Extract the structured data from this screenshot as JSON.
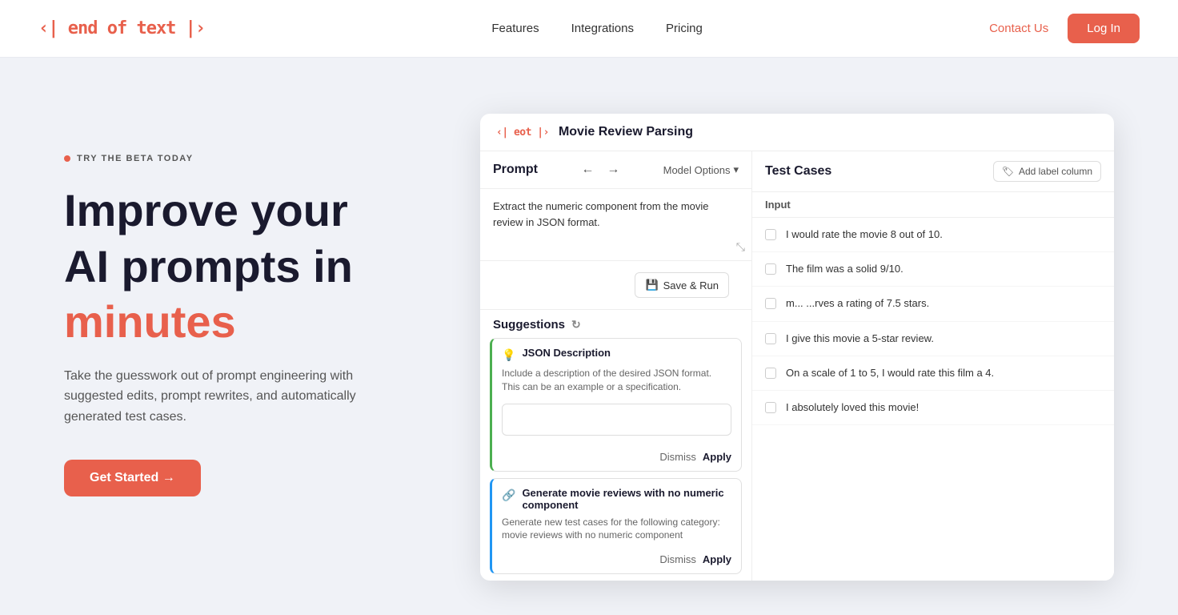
{
  "nav": {
    "logo": "‹| end of text |›",
    "links": [
      {
        "label": "Features",
        "id": "features"
      },
      {
        "label": "Integrations",
        "id": "integrations"
      },
      {
        "label": "Pricing",
        "id": "pricing"
      }
    ],
    "contact_label": "Contact Us",
    "login_label": "Log In"
  },
  "hero": {
    "badge": "TRY THE BETA TODAY",
    "title_line1": "Improve your",
    "title_line2": "AI prompts in",
    "title_accent": "minutes",
    "subtitle": "Take the guesswork out of prompt engineering with suggested edits, prompt rewrites, and automatically generated test cases.",
    "cta_label": "Get Started →"
  },
  "app": {
    "logo": "‹| eot |›",
    "title": "Movie Review Parsing",
    "prompt_label": "Prompt",
    "model_options_label": "Model Options",
    "prompt_text": "Extract the numeric component from the movie review in JSON format.",
    "save_run_label": "Save & Run",
    "suggestions_label": "Suggestions",
    "suggestions": [
      {
        "id": "json",
        "icon": "💡",
        "title": "JSON Description",
        "desc": "Include a description of the desired JSON format. This can be an example or a specification.",
        "has_input": true,
        "dismiss_label": "Dismiss",
        "apply_label": "Apply",
        "border_color": "#4caf50"
      },
      {
        "id": "generate",
        "icon": "🔗",
        "title": "Generate movie reviews with no numeric component",
        "desc": "Generate new test cases for the following category: movie reviews with no numeric component",
        "has_input": false,
        "dismiss_label": "Dismiss",
        "apply_label": "Apply",
        "border_color": "#2196f3"
      }
    ],
    "test_cases_label": "Test Cases",
    "add_label_col_label": "Add label column",
    "input_col_header": "Input",
    "test_rows": [
      {
        "text": "I would rate the movie 8 out of 10."
      },
      {
        "text": "The film was a solid 9/10."
      },
      {
        "text": "m... ...rves a rating of 7.5 stars."
      },
      {
        "text": "I give this movie a 5-star review."
      },
      {
        "text": "On a scale of 1 to 5, I would rate this film a 4."
      },
      {
        "text": "I absolutely loved this movie!"
      }
    ]
  },
  "colors": {
    "accent": "#e8604c",
    "dark": "#1a1a2e",
    "bg": "#f0f2f7"
  }
}
